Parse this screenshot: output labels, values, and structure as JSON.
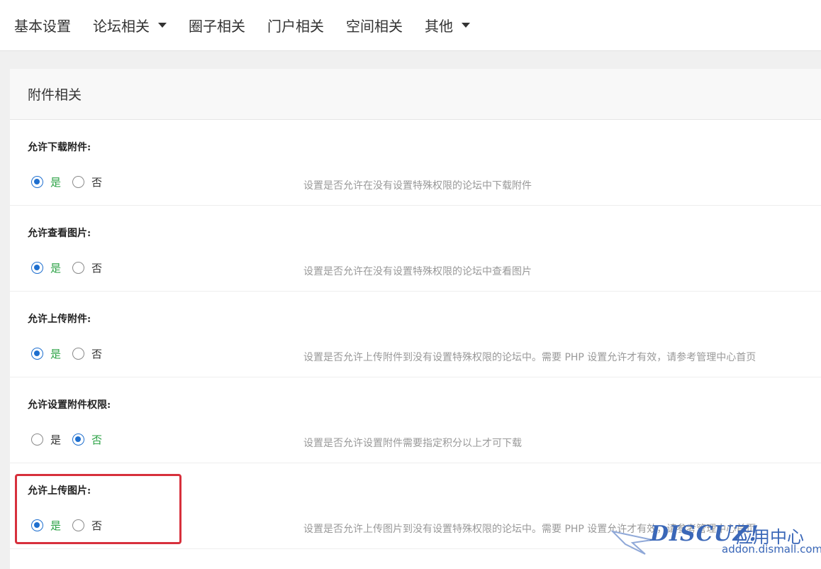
{
  "nav": {
    "items": [
      {
        "label": "基本设置",
        "dropdown": false
      },
      {
        "label": "论坛相关",
        "dropdown": true
      },
      {
        "label": "圈子相关",
        "dropdown": false
      },
      {
        "label": "门户相关",
        "dropdown": false
      },
      {
        "label": "空间相关",
        "dropdown": false
      },
      {
        "label": "其他",
        "dropdown": true
      }
    ]
  },
  "panel": {
    "title": "附件相关",
    "settings": [
      {
        "label": "允许下载附件:",
        "yes": "是",
        "no": "否",
        "selected": "yes",
        "desc": "设置是否允许在没有设置特殊权限的论坛中下载附件"
      },
      {
        "label": "允许查看图片:",
        "yes": "是",
        "no": "否",
        "selected": "yes",
        "desc": "设置是否允许在没有设置特殊权限的论坛中查看图片"
      },
      {
        "label": "允许上传附件:",
        "yes": "是",
        "no": "否",
        "selected": "yes",
        "desc": "设置是否允许上传附件到没有设置特殊权限的论坛中。需要 PHP 设置允许才有效，请参考管理中心首页"
      },
      {
        "label": "允许设置附件权限:",
        "yes": "是",
        "no": "否",
        "selected": "no",
        "desc": "设置是否允许设置附件需要指定积分以上才可下载"
      },
      {
        "label": "允许上传图片:",
        "yes": "是",
        "no": "否",
        "selected": "yes",
        "desc": "设置是否允许上传图片到没有设置特殊权限的论坛中。需要 PHP 设置允许才有效，请参考管理中心首页"
      }
    ]
  },
  "watermark": {
    "logo": "DISCUZ!",
    "cn": "应用中心",
    "url": "addon.dismall.com"
  },
  "colors": {
    "radio_on": "#1e6fcf",
    "selected_label": "#2ba245",
    "highlight_box": "#d7303c",
    "watermark": "#3a67b8"
  }
}
